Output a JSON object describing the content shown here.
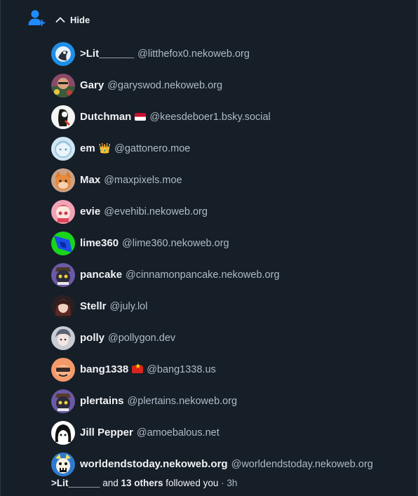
{
  "header": {
    "icon": "person-plus-icon",
    "toggle_label": "Hide",
    "toggle_icon": "chevron-up-icon",
    "accent_color": "#208bfe"
  },
  "followers": [
    {
      "name": ">Lit______",
      "handle": "@litthefox0.nekoweb.org",
      "badge": null
    },
    {
      "name": "Gary",
      "handle": "@garyswod.nekoweb.org",
      "badge": null
    },
    {
      "name": "Dutchman",
      "handle": "@keesdeboer1.bsky.social",
      "badge": "flag-netherlands"
    },
    {
      "name": "em",
      "handle": "@gattonero.moe",
      "badge": "crown-emoji"
    },
    {
      "name": "Max",
      "handle": "@maxpixels.moe",
      "badge": null
    },
    {
      "name": "evie",
      "handle": "@evehibi.nekoweb.org",
      "badge": null
    },
    {
      "name": "lime360",
      "handle": "@lime360.nekoweb.org",
      "badge": null
    },
    {
      "name": "pancake",
      "handle": "@cinnamonpancake.nekoweb.org",
      "badge": null
    },
    {
      "name": "Stellr",
      "handle": "@july.lol",
      "badge": null
    },
    {
      "name": "polly",
      "handle": "@pollygon.dev",
      "badge": null
    },
    {
      "name": "bang1338",
      "handle": "@bang1338.us",
      "badge": "flag-vietnam"
    },
    {
      "name": "plertains",
      "handle": "@plertains.nekoweb.org",
      "badge": null
    },
    {
      "name": "Jill Pepper",
      "handle": "@amoebalous.net",
      "badge": null
    },
    {
      "name": "worldendstoday.nekoweb.org",
      "handle": "@worldendstoday.nekoweb.org",
      "badge": null
    }
  ],
  "summary": {
    "first_name": ">Lit______",
    "and": "and",
    "others": "13 others",
    "action": "followed you",
    "separator": "·",
    "time": "3h"
  }
}
